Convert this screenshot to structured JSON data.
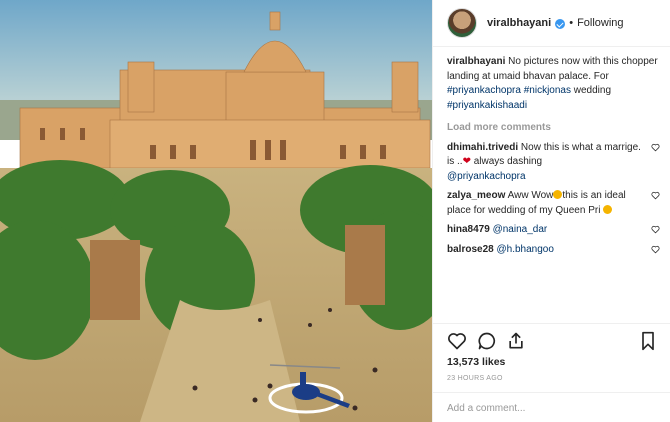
{
  "post": {
    "username": "viralbhayani",
    "follow_status": "Following",
    "separator": "•",
    "caption": {
      "username": "viralbhayani",
      "text": "No pictures now with this chopper landing at umaid bhavan palace. For",
      "tags": [
        "#priyankachopra",
        "#nickjonas",
        "wedding",
        "#priyankakishaadi"
      ]
    },
    "load_more": "Load more comments",
    "comments": [
      {
        "user": "dhimahi.trivedi",
        "text_before": "Now this is what a marrige. is ..",
        "text_after": " always dashing",
        "mention": "@priyankachopra"
      },
      {
        "user": "zalya_meow",
        "text_before": "Aww Wow",
        "text_after": "this is an ideal place for wedding of my Queen Pri"
      },
      {
        "user": "hina8479",
        "mention": "@naina_dar"
      },
      {
        "user": "balrose28",
        "mention": "@h.bhangoo"
      }
    ],
    "likes": "13,573 likes",
    "timestamp": "23 HOURS AGO",
    "add_comment_placeholder": "Add a comment..."
  },
  "colors": {
    "text": "#262626",
    "muted": "#999999",
    "link": "#003569",
    "verified": "#3897f0"
  },
  "icons": [
    "verified-badge-icon",
    "heart-icon",
    "comment-icon",
    "share-icon",
    "bookmark-icon",
    "red-heart-emoji",
    "heart-eyes-emoji",
    "crying-emoji"
  ]
}
